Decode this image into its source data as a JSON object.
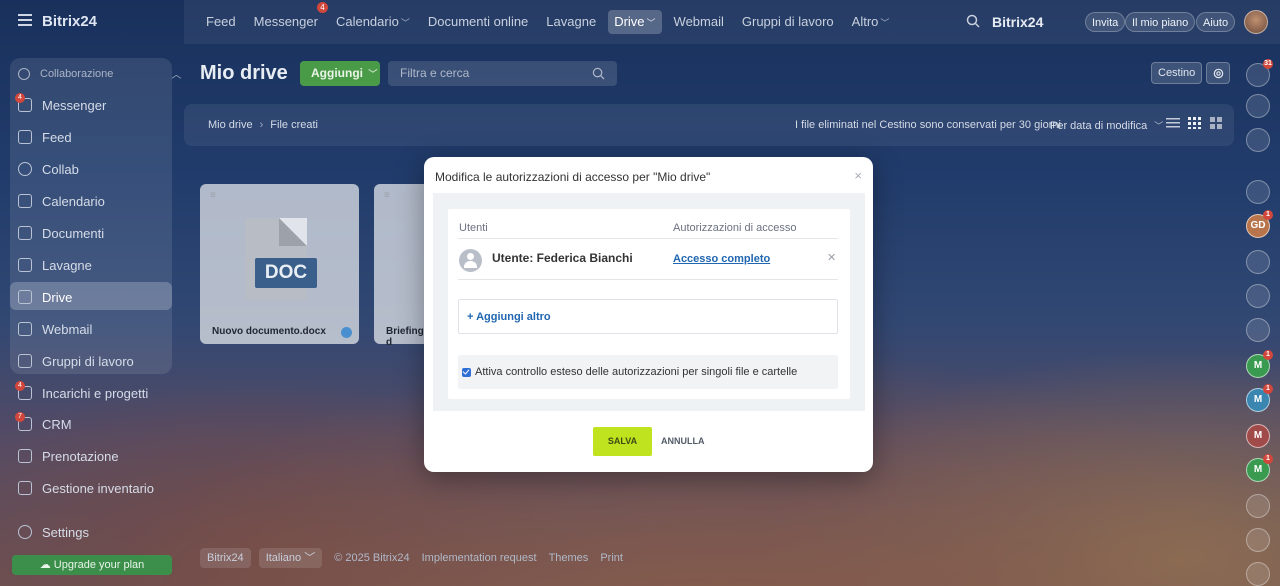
{
  "app": {
    "logo": "Bitrix24",
    "brand": "Bitrix24"
  },
  "topnav": [
    {
      "label": "Feed",
      "chevron": false
    },
    {
      "label": "Messenger",
      "badge": "4",
      "chevron": false
    },
    {
      "label": "Calendario",
      "chevron": true
    },
    {
      "label": "Documenti online",
      "chevron": false
    },
    {
      "label": "Lavagne",
      "chevron": false
    },
    {
      "label": "Drive",
      "chevron": true,
      "active": true
    },
    {
      "label": "Webmail",
      "chevron": false
    },
    {
      "label": "Gruppi di lavoro",
      "chevron": false
    },
    {
      "label": "Altro",
      "chevron": true
    }
  ],
  "top_buttons": {
    "invite": "Invita",
    "plan": "Il mio piano",
    "help": "Aiuto"
  },
  "sidebar": {
    "group_label": "Collaborazione",
    "items": [
      {
        "label": "Messenger",
        "badge": "4",
        "icon": "chat-icon"
      },
      {
        "label": "Feed",
        "icon": "feed-icon"
      },
      {
        "label": "Collab",
        "icon": "collab-icon"
      },
      {
        "label": "Calendario",
        "icon": "calendar-icon"
      },
      {
        "label": "Documenti",
        "icon": "document-icon"
      },
      {
        "label": "Lavagne",
        "icon": "board-icon"
      },
      {
        "label": "Drive",
        "icon": "drive-icon",
        "active": true
      },
      {
        "label": "Webmail",
        "icon": "mail-icon"
      },
      {
        "label": "Gruppi di lavoro",
        "icon": "groups-icon"
      },
      {
        "label": "Incarichi e progetti",
        "badge": "4",
        "icon": "tasks-icon"
      },
      {
        "label": "CRM",
        "badge": "7",
        "icon": "crm-icon"
      },
      {
        "label": "Prenotazione",
        "icon": "booking-icon"
      },
      {
        "label": "Gestione inventario",
        "icon": "inventory-icon"
      },
      {
        "label": "Settings",
        "icon": "settings-icon"
      }
    ],
    "upgrade": "Upgrade your plan"
  },
  "main": {
    "title": "Mio drive",
    "add_label": "Aggiungi",
    "search_placeholder": "Filtra e cerca",
    "bin_label": "Cestino",
    "breadcrumb": [
      "Mio drive",
      "File creati"
    ],
    "info": "I file eliminati nel Cestino sono conservati per 30 giorni",
    "sort": "Per data di modifica",
    "files": [
      {
        "name": "Nuovo documento.docx",
        "type": "DOC"
      },
      {
        "name": "Briefing d"
      }
    ]
  },
  "footer": {
    "brand": "Bitrix24",
    "lang": "Italiano",
    "copyright": "© 2025 Bitrix24",
    "links": [
      "Implementation request",
      "Themes",
      "Print"
    ]
  },
  "rail": [
    {
      "text": "",
      "badge": "31",
      "icon": "bell-icon"
    },
    {
      "text": "",
      "icon": "copilot-icon"
    },
    {
      "text": "",
      "icon": "chat-bubble-icon"
    },
    {
      "text": "",
      "icon": "ring-icon"
    },
    {
      "text": "GD",
      "badge": "1",
      "color": "#b8744a"
    },
    {
      "text": "",
      "icon": "pattern-icon"
    },
    {
      "text": "",
      "icon": "spiral-icon"
    },
    {
      "text": "",
      "icon": "spiral-icon"
    },
    {
      "text": "M",
      "badge": "1",
      "color": "#3a9a50"
    },
    {
      "text": "M",
      "badge": "1",
      "color": "#3a86b0"
    },
    {
      "text": "M",
      "color": "#a04a4a"
    },
    {
      "text": "M",
      "badge": "1",
      "color": "#3a9a50"
    },
    {
      "text": "",
      "icon": "bookmark-icon"
    },
    {
      "text": "",
      "icon": "comment-icon"
    },
    {
      "text": "",
      "icon": "note-icon"
    }
  ],
  "dialog": {
    "title": "Modifica le autorizzazioni di accesso per \"Mio drive\"",
    "col_users": "Utenti",
    "col_access": "Autorizzazioni di accesso",
    "user": "Utente: Federica Bianchi",
    "access": "Accesso completo",
    "add_more": "Aggiungi altro",
    "checkbox_label": "Attiva controllo esteso delle autorizzazioni per singoli file e cartelle",
    "checkbox_checked": true,
    "save": "SALVA",
    "cancel": "ANNULLA"
  },
  "colors": {
    "accent_green": "#bfe31f",
    "highlight": "#e0393c",
    "link": "#2066b0"
  }
}
